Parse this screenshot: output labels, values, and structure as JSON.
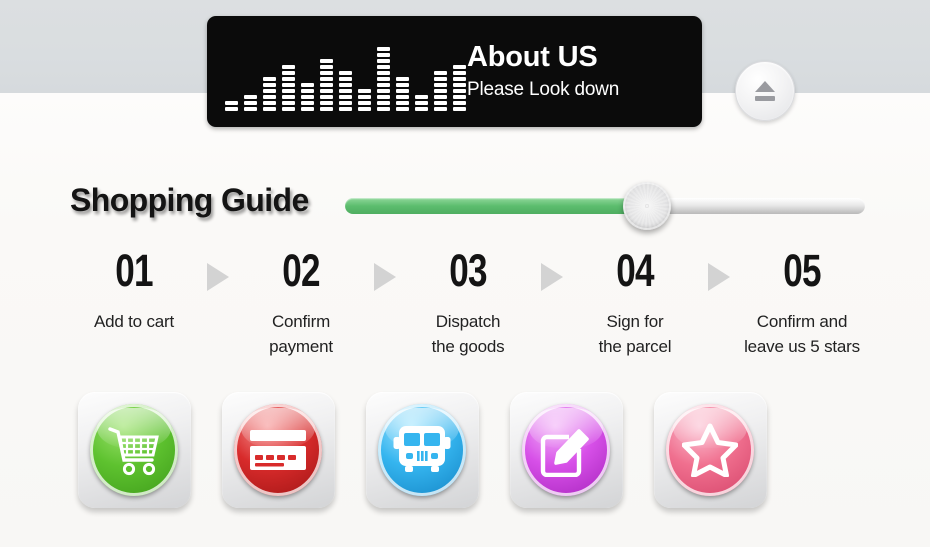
{
  "banner": {
    "title": "About US",
    "subtitle": "Please Look down",
    "equalizer_heights": [
      2,
      3,
      6,
      8,
      5,
      9,
      7,
      4,
      11,
      6,
      3,
      7,
      8
    ]
  },
  "eject": {
    "name": "eject-button"
  },
  "guide": {
    "title": "Shopping Guide",
    "progress_percent": 58
  },
  "steps": [
    {
      "number": "01",
      "label": "Add to cart",
      "icon": "shopping-cart-icon",
      "color": "#5ec22f"
    },
    {
      "number": "02",
      "label": "Confirm\npayment",
      "icon": "credit-card-icon",
      "color": "#d82b2b"
    },
    {
      "number": "03",
      "label": "Dispatch\nthe goods",
      "icon": "delivery-truck-icon",
      "color": "#35b5ef"
    },
    {
      "number": "04",
      "label": "Sign for\nthe parcel",
      "icon": "edit-pencil-icon",
      "color": "#d750e8"
    },
    {
      "number": "05",
      "label": "Confirm and\nleave us 5 stars",
      "icon": "star-icon",
      "color": "#f0708f"
    }
  ],
  "arrow_count": 4,
  "colors": {
    "banner_bg": "#0b0b0b",
    "top_band": "#dadee0",
    "page_bg": "#f8f7f5",
    "slider_fill": "#5cbd6e",
    "arrow_gray": "#d3d3d3"
  }
}
